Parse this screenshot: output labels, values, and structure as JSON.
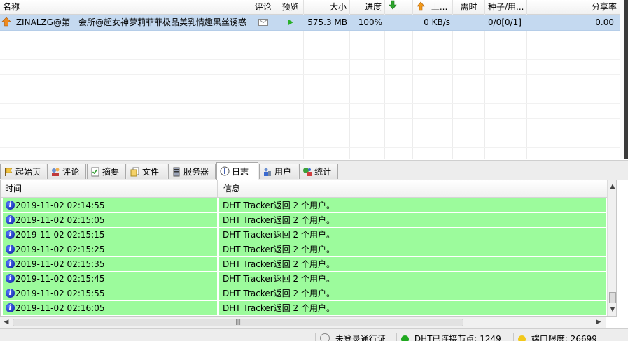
{
  "columns": {
    "name": "名称",
    "comment": "评论",
    "preview": "预览",
    "size": "大小",
    "progress": "进度",
    "download_speed": "",
    "upload_speed": "上...",
    "eta": "需时",
    "seeds_peers": "种子/用...",
    "ratio": "分享率"
  },
  "torrent": {
    "name": "ZINALZG@第一会所@超女神萝莉菲菲极品美乳情趣黑丝诱惑",
    "size": "575.3 MB",
    "progress": "100%",
    "upload_speed": "0 KB/s",
    "seeds_peers": "0/0[0/1]",
    "ratio": "0.00"
  },
  "tabs": [
    {
      "label": "起始页",
      "icon": "home-page-icon"
    },
    {
      "label": "评论",
      "icon": "comment-icon"
    },
    {
      "label": "摘要",
      "icon": "summary-icon"
    },
    {
      "label": "文件",
      "icon": "file-icon"
    },
    {
      "label": "服务器",
      "icon": "server-icon"
    },
    {
      "label": "日志",
      "icon": "info-icon",
      "active": true
    },
    {
      "label": "用户",
      "icon": "user-icon"
    },
    {
      "label": "统计",
      "icon": "statistics-icon"
    }
  ],
  "log": {
    "col_time": "时间",
    "col_message": "信息",
    "row_color": "#9cfb9c",
    "entries": [
      {
        "time": "2019-11-02 02:14:55",
        "message": "DHT Tracker返回 2 个用户。"
      },
      {
        "time": "2019-11-02 02:15:05",
        "message": "DHT Tracker返回 2 个用户。"
      },
      {
        "time": "2019-11-02 02:15:15",
        "message": "DHT Tracker返回 2 个用户。"
      },
      {
        "time": "2019-11-02 02:15:25",
        "message": "DHT Tracker返回 2 个用户。"
      },
      {
        "time": "2019-11-02 02:15:35",
        "message": "DHT Tracker返回 2 个用户。"
      },
      {
        "time": "2019-11-02 02:15:45",
        "message": "DHT Tracker返回 2 个用户。"
      },
      {
        "time": "2019-11-02 02:15:55",
        "message": "DHT Tracker返回 2 个用户。"
      },
      {
        "time": "2019-11-02 02:16:05",
        "message": "DHT Tracker返回 2 个用户。"
      }
    ]
  },
  "status_bar": {
    "login": "未登录通行证",
    "dht": "DHT已连接节点: 1249",
    "port": "端口限度: 26699"
  },
  "colors": {
    "selected_row": "#c4d9f0",
    "log_row": "#9cfb9c"
  }
}
